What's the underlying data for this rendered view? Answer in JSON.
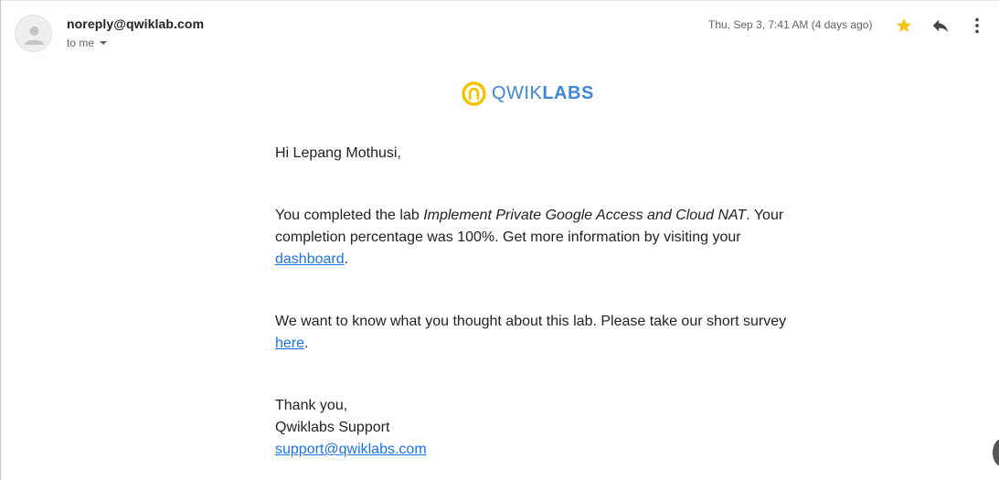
{
  "email": {
    "sender": "noreply@qwiklab.com",
    "recipient_label": "to me",
    "timestamp": "Thu, Sep 3, 7:41 AM (4 days ago)"
  },
  "icons": {
    "avatar": "person-icon",
    "star": "star-icon",
    "reply": "reply-icon",
    "more": "more-vertical-icon"
  },
  "logo": {
    "light_text": "QWIK",
    "bold_text": "LABS",
    "ring_color": "#f2c400",
    "text_color": "#3f86d6"
  },
  "message": {
    "greeting": "Hi Lepang Mothusi,",
    "para1_prefix": "You completed the lab ",
    "para1_lab_name": "Implement Private Google Access and Cloud NAT",
    "para1_suffix": ". Your completion percentage was 100%. Get more information by visiting your ",
    "para1_link": "dashboard",
    "para1_end": ".",
    "para2_prefix": "We want to know what you thought about this lab. Please take our short survey ",
    "para2_link": "here",
    "para2_end": ".",
    "signoff_thanks": "Thank you,",
    "signoff_team": "Qwiklabs Support",
    "signoff_email": "support@qwiklabs.com"
  },
  "colors": {
    "link": "#1a73e8",
    "star": "#f4c20d",
    "meta_text": "#5f6368"
  }
}
